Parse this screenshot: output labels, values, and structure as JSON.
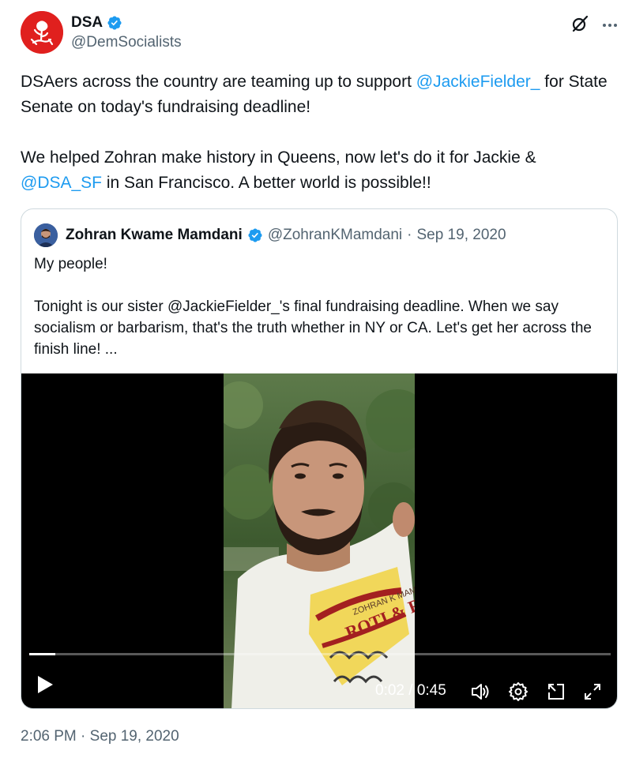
{
  "post": {
    "author_name": "DSA",
    "author_handle": "@DemSocialists",
    "text_p1_a": "DSAers across the country are teaming up to support ",
    "mention_1": "@JackieFielder_",
    "text_p1_b": " for State Senate on today's fundraising deadline!",
    "text_p2_a": "We helped Zohran make history in Queens, now let's do it for Jackie & ",
    "mention_2": "@DSA_SF",
    "text_p2_b": " in San Francisco. A better world is possible!!",
    "timestamp": "2:06 PM · Sep 19, 2020"
  },
  "quote": {
    "author_name": "Zohran Kwame Mamdani",
    "author_handle": "@ZohranKMamdani",
    "separator": "·",
    "date": "Sep 19, 2020",
    "line1": "My people!",
    "line2": "Tonight is our sister @JackieFielder_'s final fundraising deadline. When we say socialism or barbarism, that's the truth whether in NY or CA. Let's get her across the finish line! ..."
  },
  "video": {
    "elapsed": "0:02",
    "time_separator": " / ",
    "duration": "0:45",
    "progress_fraction": 0.045,
    "shirt_text": "ROTI & ROSES",
    "shirt_subtext": "ZOHRAN K MAMDANI"
  },
  "colors": {
    "link": "#1d9bf0",
    "verified": "#1d9bf0",
    "secondary_text": "#536471",
    "avatar_red": "#e0201e"
  },
  "icons": [
    "verified-badge-icon",
    "grok-icon",
    "more-icon",
    "play-icon",
    "volume-icon",
    "settings-icon",
    "pip-icon",
    "fullscreen-icon"
  ]
}
